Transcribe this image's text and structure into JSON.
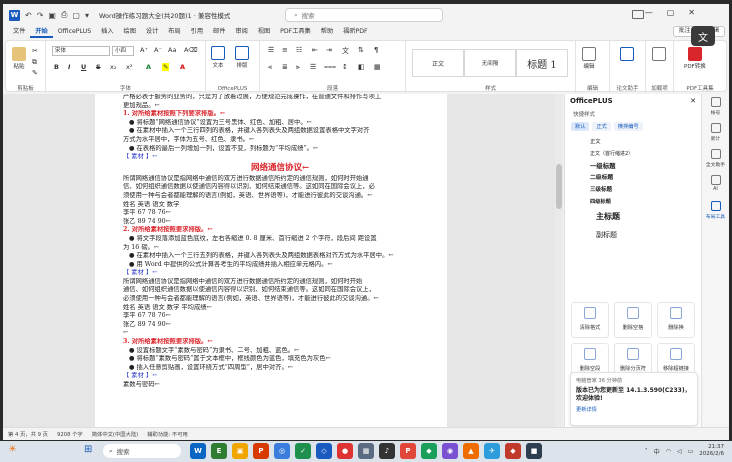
{
  "window": {
    "title": "Word操作练习题大全(共20题)1 · 兼容性模式",
    "search_placeholder": "搜索",
    "controls": [
      "—",
      "▢",
      "✕"
    ]
  },
  "ribbon_tabs": [
    "文件",
    "开始",
    "OfficePLUS",
    "插入",
    "绘图",
    "设计",
    "布局",
    "引用",
    "邮件",
    "审阅",
    "视图",
    "PDF工具集",
    "帮助",
    "福昕PDF"
  ],
  "ribbon_tab_active": "开始",
  "ribbon_right": {
    "comments": "批注",
    "editing": "编辑"
  },
  "ribbon": {
    "paste": "粘贴",
    "font_name": "宋体",
    "font_size": "小四",
    "format_buttons": [
      "B",
      "I",
      "U",
      "S",
      "x₂",
      "x²",
      "A"
    ],
    "officeplus_buttons": [
      "文本",
      "排版"
    ],
    "styles": [
      "正文",
      "无间隔",
      "标题 1"
    ],
    "edit_btn": "编辑",
    "protect_btn": "",
    "addin_btn": "加载项",
    "pdf_btn": "PDF转换",
    "groups": [
      "剪贴板",
      "字体",
      "OfficePLUS",
      "段落",
      "样式",
      "编辑",
      "论文助手",
      "加载项",
      "PDF工具集"
    ]
  },
  "document": {
    "lines": [
      {
        "t": "产格必表于服务的业务的，只是为了放着过展，方便规范完成操作，在普通文件和排作写项工",
        "c": ""
      },
      {
        "t": "更加规品。←",
        "c": ""
      },
      {
        "t": "1. 对所给素材按照下列要求排版。←",
        "c": "red"
      },
      {
        "t": "●  将标题“网络通信协议”设置为三号黑体、红色、加粗、居中。←",
        "c": "ind"
      },
      {
        "t": "●  在素材中插入一个三行四列的表格，并键入各列表头及两组数据设置表格中文字对齐",
        "c": "ind"
      },
      {
        "t": "方式为水平居中，字体为五号、红色、隶书。←",
        "c": ""
      },
      {
        "t": "●  在表格的最后一列增加一列，设置不变，列标题为“平均成绩”。←",
        "c": "ind"
      },
      {
        "t": "【 素材 】←",
        "c": "blue"
      },
      {
        "t": "网络通信协议←",
        "c": "title"
      },
      {
        "t": "   所谓网络通信协议是指网络中通信的双方进行数据通信所约定的通信规则，如何时开始通",
        "c": ""
      },
      {
        "t": "信、如何组织通信数据以使通信内容得以识别、如何结束通信等。这如同在国际会议上，必",
        "c": ""
      },
      {
        "t": "须使用一种与会者都能理解的语言(例如，英语、世界语等)，才能进行彼此的交谈沟通。←",
        "c": ""
      },
      {
        "t": "姓名    英语    语文    数学",
        "c": ""
      },
      {
        "t": "李平    67  78  76←",
        "c": ""
      },
      {
        "t": "张乙    89  74  90←",
        "c": ""
      },
      {
        "t": "2. 对所给素材按照要求排版。←",
        "c": "red"
      },
      {
        "t": "●  将文字段落添加蓝色底纹，左右各缩进 0. 8 厘米、首行缩进 2 个字符，段后间 距设置",
        "c": "ind"
      },
      {
        "t": "为 16 磅。←",
        "c": ""
      },
      {
        "t": "●  在素材中插入一个三行五列的表格，并键入各列表头及两组数据表格对齐方式为水平居中。←",
        "c": "ind"
      },
      {
        "t": "●  用 Word 中提供的公式计算各考生的平均成绩并插入相应单元格内。←",
        "c": "ind"
      },
      {
        "t": "【 素材 】←",
        "c": "blue"
      },
      {
        "t": "   所谓网络通信协议是指网络中通信的双方进行数据通信所约定的通信规则，如何时开始",
        "c": ""
      },
      {
        "t": "通信、如何组织通信数据以使通信内容得以识别、如何结束通信等。这如同在国际会议上，",
        "c": ""
      },
      {
        "t": "必须使用一种与会者都能理解的语言(例如，英语、世界语等)，才能进行彼此的交谈沟通。←",
        "c": ""
      },
      {
        "t": "姓名    英语    语文    数学    平均成绩←",
        "c": ""
      },
      {
        "t": "李平    67  78  76←",
        "c": ""
      },
      {
        "t": "张乙    89  74  90←",
        "c": ""
      },
      {
        "t": "←",
        "c": ""
      },
      {
        "t": "3. 对所给素材按照要求排版。←",
        "c": "red"
      },
      {
        "t": "●  设置标题文字“素数与密码”为隶书、二号、加粗、蓝色。←",
        "c": "ind"
      },
      {
        "t": "●  将标题“素数与密码”置于文本框中，框线颜色为蓝色，填充色为灰色←",
        "c": "ind"
      },
      {
        "t": "●  插入任意剪贴画，设置环绕方式“四周型”，居中对齐。←",
        "c": "ind"
      },
      {
        "t": "【 素材 】←",
        "c": "blue"
      },
      {
        "t": "素数与密码←",
        "c": ""
      }
    ]
  },
  "pane": {
    "title": "OfficePLUS",
    "subtitle": "快捷样式",
    "tabs": [
      "默认",
      "正式",
      "横排编号"
    ],
    "style_items": [
      {
        "label": "正文",
        "w": "normal",
        "s": "5.3px"
      },
      {
        "label": "正文（首行缩进2）",
        "w": "normal",
        "s": "5px"
      },
      {
        "label": "一级标题",
        "w": "bold",
        "s": "6.4px"
      },
      {
        "label": "二级标题",
        "w": "bold",
        "s": "5.8px"
      },
      {
        "label": "三级标题",
        "w": "bold",
        "s": "5.5px"
      },
      {
        "label": "四级标题",
        "w": "bold",
        "s": "5.2px"
      },
      {
        "label": "主标题",
        "w": "bold",
        "s": "8px"
      },
      {
        "label": "副标题",
        "w": "normal",
        "s": "7px"
      }
    ],
    "tiles": [
      "清除格式",
      "删除空格",
      "删除换",
      "删除空段",
      "删除分页符",
      "移除超链接"
    ],
    "notif_app": "电脑管家",
    "notif_time": "36 分钟前",
    "notif_title": "版本已为您更新至 14.1.3.590(C233)，欢迎体验!",
    "notif_action": "更新详情"
  },
  "rail": [
    {
      "label": "帐号",
      "on": false
    },
    {
      "label": "新计",
      "on": false
    },
    {
      "label": "全文助手",
      "on": false
    },
    {
      "label": "AI",
      "on": false
    },
    {
      "label": "布局工具",
      "on": true
    }
  ],
  "status": {
    "page": "第 4 页，共 9 页",
    "words": "9208 个字",
    "lang": "简体中文(中国大陆)",
    "access": "辅助功能: 不可用"
  },
  "taskbar": {
    "search_placeholder": "搜索",
    "time": "21:37",
    "date": "2026/2/6",
    "lang": "中",
    "apps": [
      {
        "c": "#0a66c2",
        "g": "W"
      },
      {
        "c": "#2f7d32",
        "g": "E"
      },
      {
        "c": "#f0a500",
        "g": "▣"
      },
      {
        "c": "#d83b01",
        "g": "P"
      },
      {
        "c": "#3b7ddd",
        "g": "◎"
      },
      {
        "c": "#1f8f4e",
        "g": "✓"
      },
      {
        "c": "#185abd",
        "g": "◇"
      },
      {
        "c": "#d33",
        "g": "●"
      },
      {
        "c": "#5a6b82",
        "g": "▦"
      },
      {
        "c": "#333",
        "g": "♪"
      },
      {
        "c": "#e0473a",
        "g": "P"
      },
      {
        "c": "#1aa05b",
        "g": "◆"
      },
      {
        "c": "#7a52d1",
        "g": "◉"
      },
      {
        "c": "#ef6c00",
        "g": "▲"
      },
      {
        "c": "#2d9cdb",
        "g": "✈"
      },
      {
        "c": "#c0392b",
        "g": "◆"
      },
      {
        "c": "#2c3e50",
        "g": "■"
      }
    ]
  },
  "colors": {
    "accent": "#185abd",
    "heading_red": "#d9262c",
    "material_blue": "#2f3fc9"
  }
}
